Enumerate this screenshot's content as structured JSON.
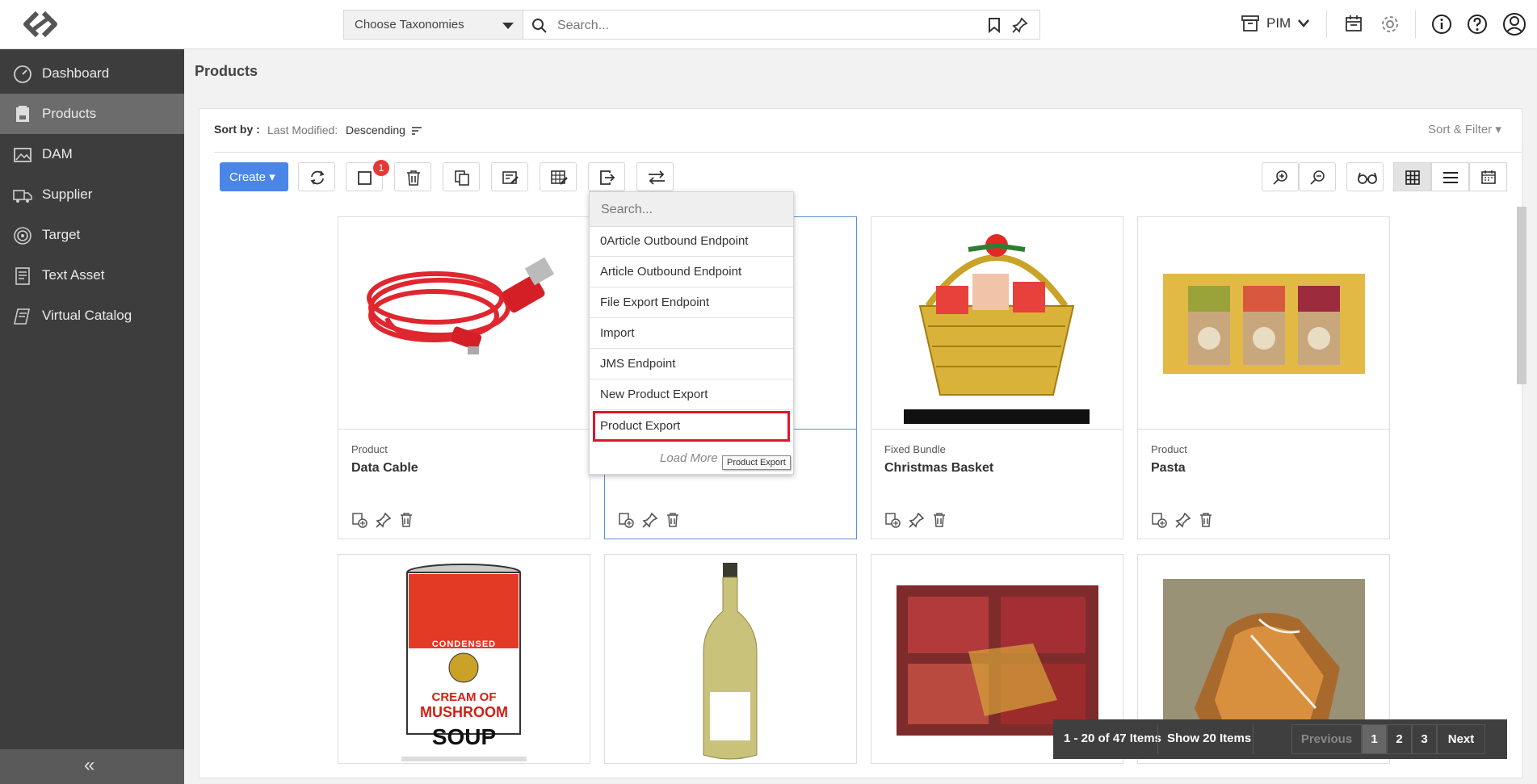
{
  "topbar": {
    "taxonomy_label": "Choose Taxonomies",
    "search_placeholder": "Search...",
    "app_switch_label": "PIM"
  },
  "sidebar": {
    "items": [
      {
        "label": "Dashboard",
        "icon": "dashboard-icon"
      },
      {
        "label": "Products",
        "icon": "products-icon"
      },
      {
        "label": "DAM",
        "icon": "image-icon"
      },
      {
        "label": "Supplier",
        "icon": "truck-icon"
      },
      {
        "label": "Target",
        "icon": "target-icon"
      },
      {
        "label": "Text Asset",
        "icon": "document-icon"
      },
      {
        "label": "Virtual Catalog",
        "icon": "catalog-icon"
      }
    ],
    "active": "Products",
    "collapse_glyph": "«"
  },
  "page": {
    "title": "Products",
    "sort_by_label": "Sort by :",
    "sort_field": "Last Modified:",
    "sort_order": "Descending",
    "sort_filter_label": "Sort & Filter ▾"
  },
  "toolbar": {
    "create_label": "Create ▾",
    "selection_count": "1"
  },
  "export_dropdown": {
    "search_placeholder": "Search...",
    "items": [
      "0Article Outbound Endpoint",
      "Article Outbound Endpoint",
      "File Export Endpoint",
      "Import",
      "JMS Endpoint",
      "New Product Export",
      "Product Export"
    ],
    "highlighted": "Product Export",
    "load_more": "Load More",
    "tooltip": "Product Export"
  },
  "cards": [
    {
      "type": "Product",
      "name": "Data Cable",
      "image": "red-usb-cable"
    },
    {
      "type": "",
      "name": "",
      "image": "hidden-by-dropdown"
    },
    {
      "type": "Fixed Bundle",
      "name": "Christmas Basket",
      "image": "gift-basket"
    },
    {
      "type": "Product",
      "name": "Pasta",
      "image": "pasta-boxes"
    },
    {
      "type": "",
      "name": "",
      "image": "soup-can"
    },
    {
      "type": "",
      "name": "",
      "image": "wine-bottle"
    },
    {
      "type": "",
      "name": "",
      "image": "cured-meat"
    },
    {
      "type": "",
      "name": "",
      "image": "bread-loaf"
    }
  ],
  "soup_can": {
    "line1": "CONDENSED",
    "line2": "CREAM OF",
    "line3": "MUSHROOM",
    "line4": "SOUP"
  },
  "pagination": {
    "count": "1 - 20 of 47 Items",
    "show": "Show 20 Items",
    "previous": "Previous",
    "pages": [
      "1",
      "2",
      "3"
    ],
    "current": "1",
    "next": "Next"
  },
  "colors": {
    "accent": "#4a86e8",
    "sidebar": "#3d3d3d",
    "highlight": "#e0162b"
  }
}
